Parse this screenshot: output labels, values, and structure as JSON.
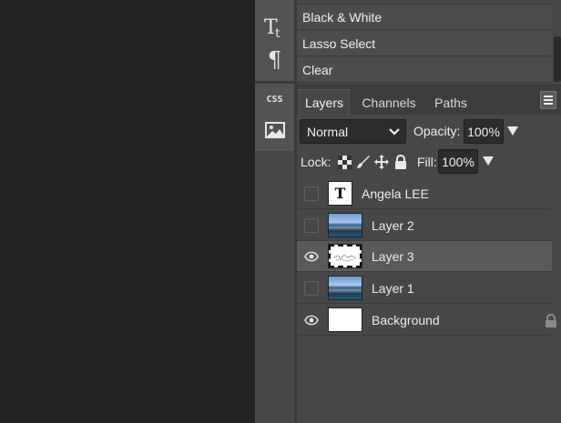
{
  "history": {
    "items": [
      {
        "label": "Black & White"
      },
      {
        "label": "Lasso Select"
      },
      {
        "label": "Clear"
      }
    ]
  },
  "tools": [
    {
      "icon": "type-tool-icon",
      "glyph": "Tt"
    },
    {
      "icon": "paragraph-icon",
      "glyph": "¶"
    },
    {
      "icon": "css-icon",
      "glyph": "CSS"
    },
    {
      "icon": "image-icon"
    }
  ],
  "tabs": [
    {
      "label": "Layers",
      "active": true
    },
    {
      "label": "Channels",
      "active": false
    },
    {
      "label": "Paths",
      "active": false
    }
  ],
  "blend": {
    "mode": "Normal",
    "opacity_label": "Opacity:",
    "opacity": "100%"
  },
  "lock": {
    "label": "Lock:",
    "fill_label": "Fill:",
    "fill": "100%"
  },
  "layers": [
    {
      "name": "Angela LEE",
      "visible": false,
      "thumb": "T",
      "type": "text"
    },
    {
      "name": "Layer 2",
      "visible": false,
      "type": "photo"
    },
    {
      "name": "Layer 3",
      "visible": true,
      "type": "mask",
      "selected": true
    },
    {
      "name": "Layer 1",
      "visible": false,
      "type": "photo"
    },
    {
      "name": "Background",
      "visible": true,
      "type": "white",
      "locked": true
    }
  ],
  "colors": {
    "workspace": "#232323",
    "panel": "#474747",
    "selected_row": "#5a5a5a"
  }
}
